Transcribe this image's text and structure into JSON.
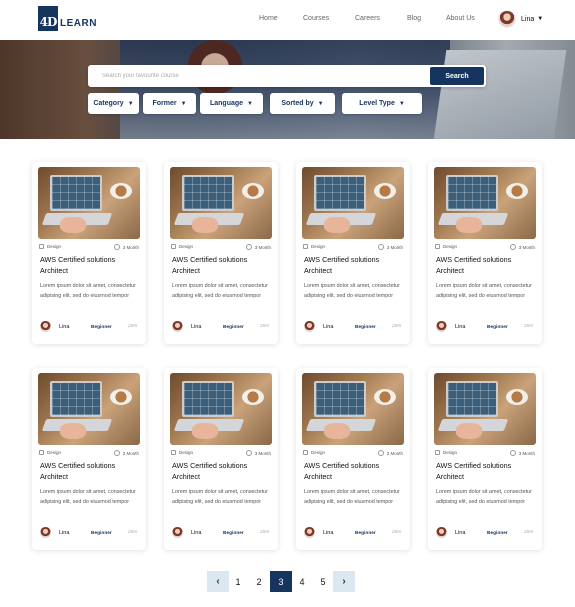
{
  "brand": {
    "mark": "4D",
    "name": "LEARN"
  },
  "nav": {
    "items": [
      "Home",
      "Courses",
      "Careers",
      "Blog",
      "About Us"
    ]
  },
  "user": {
    "name": "Lina"
  },
  "search": {
    "placeholder": "Search your favourite course",
    "button": "Search"
  },
  "filters": [
    "Category",
    "Former",
    "Language",
    "Sorted by",
    "Level Type"
  ],
  "cards": [
    {
      "category": "Design",
      "duration": "3 Month",
      "title": "AWS Certified solutions Architect",
      "description": "Lorem ipsum dolor sit amet, consectetur adipising elit, sed do eiusmod tempor",
      "author": "Lina",
      "level": "Beginner",
      "time": "20m"
    },
    {
      "category": "Design",
      "duration": "3 Month",
      "title": "AWS Certified solutions Architect",
      "description": "Lorem ipsum dolor sit amet, consectetur adipising elit, sed do eiusmod tempor",
      "author": "Lina",
      "level": "Beginner",
      "time": "20m"
    },
    {
      "category": "Design",
      "duration": "3 Month",
      "title": "AWS Certified solutions Architect",
      "description": "Lorem ipsum dolor sit amet, consectetur adipising elit, sed do eiusmod tempor",
      "author": "Lina",
      "level": "Beginner",
      "time": "20m"
    },
    {
      "category": "Design",
      "duration": "3 Month",
      "title": "AWS Certified solutions Architect",
      "description": "Lorem ipsum dolor sit amet, consectetur adipising elit, sed do eiusmod tempor",
      "author": "Lina",
      "level": "Beginner",
      "time": "20m"
    },
    {
      "category": "Design",
      "duration": "3 Month",
      "title": "AWS Certified solutions Architect",
      "description": "Lorem ipsum dolor sit amet, consectetur adipising elit, sed do eiusmod tempor",
      "author": "Lina",
      "level": "Beginner",
      "time": "20m"
    },
    {
      "category": "Design",
      "duration": "3 Month",
      "title": "AWS Certified solutions Architect",
      "description": "Lorem ipsum dolor sit amet, consectetur adipising elit, sed do eiusmod tempor",
      "author": "Lina",
      "level": "Beginner",
      "time": "20m"
    },
    {
      "category": "Design",
      "duration": "3 Month",
      "title": "AWS Certified solutions Architect",
      "description": "Lorem ipsum dolor sit amet, consectetur adipising elit, sed do eiusmod tempor",
      "author": "Lina",
      "level": "Beginner",
      "time": "20m"
    },
    {
      "category": "Design",
      "duration": "3 Month",
      "title": "AWS Certified solutions Architect",
      "description": "Lorem ipsum dolor sit amet, consectetur adipising elit, sed do eiusmod tempor",
      "author": "Lina",
      "level": "Beginner",
      "time": "20m"
    }
  ],
  "pagination": {
    "pages": [
      "1",
      "2",
      "3",
      "4",
      "5"
    ],
    "current": "3",
    "prev_icon": "chevron-left-icon",
    "next_icon": "chevron-right-icon"
  },
  "colors": {
    "primary": "#15355f",
    "arrow_bg": "#dbe8f0"
  }
}
